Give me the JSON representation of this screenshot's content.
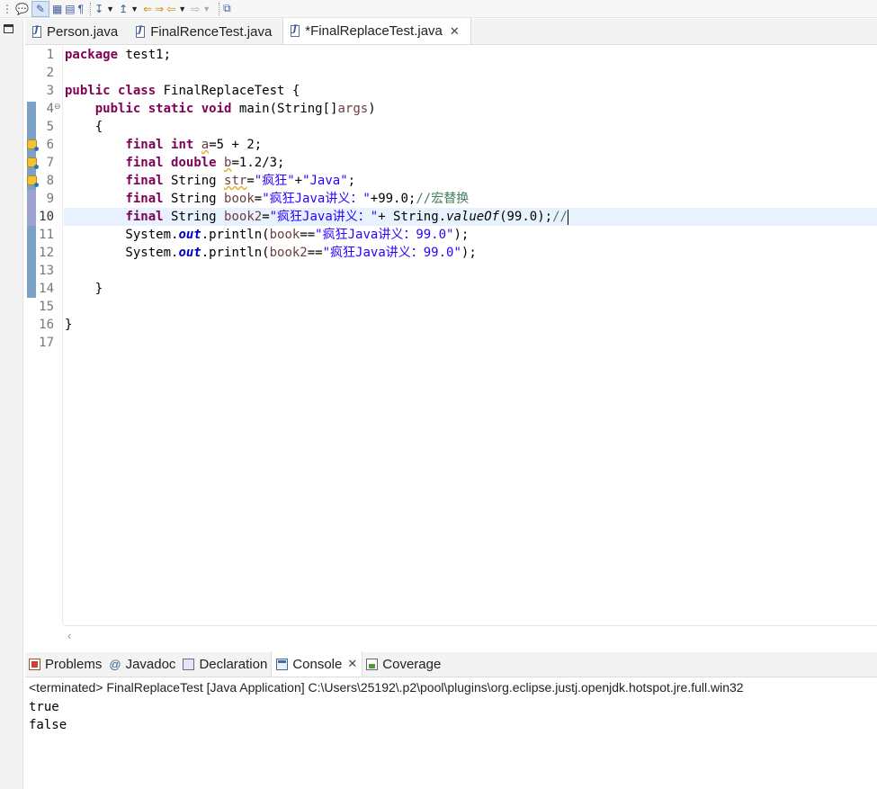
{
  "toolbar": {
    "items": [
      "pin-editor-icon",
      "toggle-mark-occurrences-icon",
      "toggle-block-selection-icon",
      "show-whitespace-icon",
      "next-annotation-icon",
      "previous-annotation-icon",
      "last-edit-location-icon",
      "back-icon",
      "forward-icon",
      "open-perspective-icon"
    ]
  },
  "editor_tabs": [
    {
      "label": "Person.java"
    },
    {
      "label": "FinalRenceTest.java"
    },
    {
      "label": "*FinalReplaceTest.java"
    }
  ],
  "code": {
    "line_numbers": [
      "1",
      "2",
      "3",
      "4",
      "5",
      "6",
      "7",
      "8",
      "9",
      "10",
      "11",
      "12",
      "13",
      "14",
      "15",
      "16",
      "17"
    ],
    "lines": [
      {
        "segs": [
          {
            "t": "package",
            "c": "kw"
          },
          {
            "t": " test1;"
          }
        ]
      },
      {
        "segs": []
      },
      {
        "segs": [
          {
            "t": "public",
            "c": "kw"
          },
          {
            "t": " "
          },
          {
            "t": "class",
            "c": "kw"
          },
          {
            "t": " FinalReplaceTest {"
          }
        ]
      },
      {
        "segs": [
          {
            "t": "    "
          },
          {
            "t": "public",
            "c": "kw"
          },
          {
            "t": " "
          },
          {
            "t": "static",
            "c": "kw"
          },
          {
            "t": " "
          },
          {
            "t": "void",
            "c": "kw"
          },
          {
            "t": " main(String[]"
          },
          {
            "t": "args",
            "c": "var"
          },
          {
            "t": ")"
          }
        ]
      },
      {
        "segs": [
          {
            "t": "    {"
          }
        ]
      },
      {
        "segs": [
          {
            "t": "        "
          },
          {
            "t": "final",
            "c": "kw"
          },
          {
            "t": " "
          },
          {
            "t": "int",
            "c": "kw"
          },
          {
            "t": " "
          },
          {
            "t": "a",
            "c": "warnvar"
          },
          {
            "t": "=5 + 2;"
          }
        ]
      },
      {
        "segs": [
          {
            "t": "        "
          },
          {
            "t": "final",
            "c": "kw"
          },
          {
            "t": " "
          },
          {
            "t": "double",
            "c": "kw"
          },
          {
            "t": " "
          },
          {
            "t": "b",
            "c": "warnvar"
          },
          {
            "t": "=1.2/3;"
          }
        ]
      },
      {
        "segs": [
          {
            "t": "        "
          },
          {
            "t": "final",
            "c": "kw"
          },
          {
            "t": " String "
          },
          {
            "t": "str",
            "c": "warnvar"
          },
          {
            "t": "="
          },
          {
            "t": "\"疯狂\"",
            "c": "str"
          },
          {
            "t": "+"
          },
          {
            "t": "\"Java\"",
            "c": "str"
          },
          {
            "t": ";"
          }
        ]
      },
      {
        "segs": [
          {
            "t": "        "
          },
          {
            "t": "final",
            "c": "kw"
          },
          {
            "t": " String "
          },
          {
            "t": "book",
            "c": "var"
          },
          {
            "t": "="
          },
          {
            "t": "\"疯狂Java讲义：\"",
            "c": "str"
          },
          {
            "t": "+99.0;"
          },
          {
            "t": "//宏替换",
            "c": "cm"
          }
        ]
      },
      {
        "segs": [
          {
            "t": "        "
          },
          {
            "t": "final",
            "c": "kw"
          },
          {
            "t": " String "
          },
          {
            "t": "book2",
            "c": "var"
          },
          {
            "t": "="
          },
          {
            "t": "\"疯狂Java讲义：\"",
            "c": "str"
          },
          {
            "t": "+ String."
          },
          {
            "t": "valueOf",
            "c": "ital"
          },
          {
            "t": "(99.0);"
          },
          {
            "t": "//",
            "c": "cm"
          },
          {
            "t": "",
            "c": "caret"
          }
        ]
      },
      {
        "segs": [
          {
            "t": "        System."
          },
          {
            "t": "out",
            "c": "fld"
          },
          {
            "t": ".println("
          },
          {
            "t": "book",
            "c": "var"
          },
          {
            "t": "=="
          },
          {
            "t": "\"疯狂Java讲义：99.0\"",
            "c": "str"
          },
          {
            "t": ");"
          }
        ]
      },
      {
        "segs": [
          {
            "t": "        System."
          },
          {
            "t": "out",
            "c": "fld"
          },
          {
            "t": ".println("
          },
          {
            "t": "book2",
            "c": "var"
          },
          {
            "t": "=="
          },
          {
            "t": "\"疯狂Java讲义：99.0\"",
            "c": "str"
          },
          {
            "t": ");"
          }
        ]
      },
      {
        "segs": []
      },
      {
        "segs": [
          {
            "t": "    }"
          }
        ]
      },
      {
        "segs": []
      },
      {
        "segs": [
          {
            "t": "}"
          }
        ]
      },
      {
        "segs": []
      }
    ],
    "current_line": 10,
    "warning_lines": [
      6,
      7,
      8
    ],
    "fold_line": 4
  },
  "console_tabs": [
    {
      "label": "Problems",
      "icon": "problems-icon"
    },
    {
      "label": "Javadoc",
      "icon": "javadoc-icon"
    },
    {
      "label": "Declaration",
      "icon": "declaration-icon"
    },
    {
      "label": "Console",
      "icon": "console-icon"
    },
    {
      "label": "Coverage",
      "icon": "coverage-icon"
    }
  ],
  "console": {
    "status": "<terminated> FinalReplaceTest [Java Application] C:\\Users\\25192\\.p2\\pool\\plugins\\org.eclipse.justj.openjdk.hotspot.jre.full.win32",
    "output": [
      "true",
      "false"
    ]
  }
}
